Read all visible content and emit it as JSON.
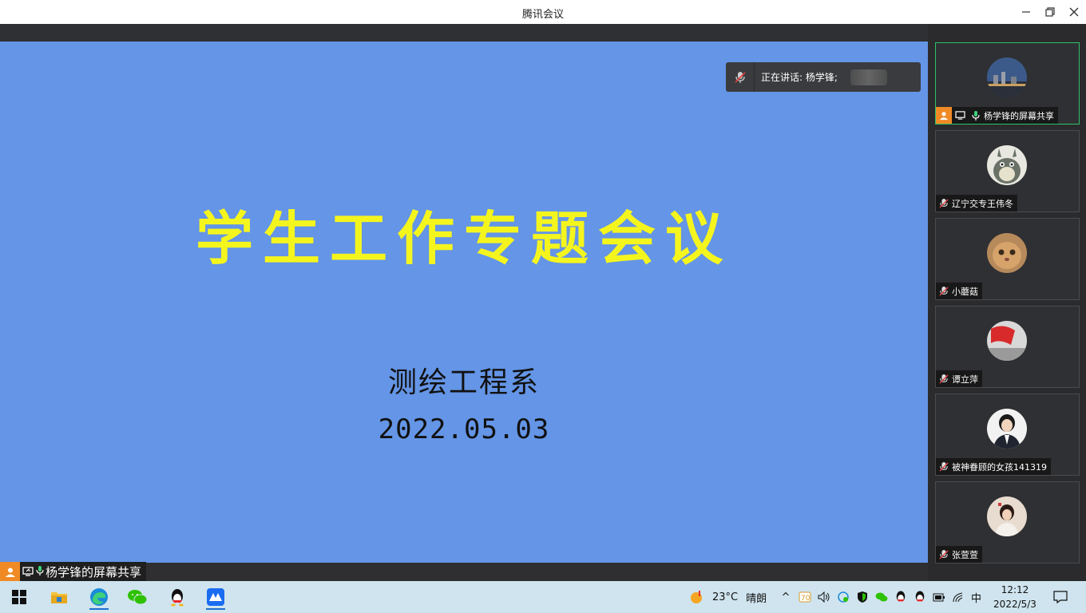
{
  "window": {
    "title": "腾讯会议"
  },
  "speaking": {
    "text": "正在讲话: 杨学锋;"
  },
  "slide": {
    "title": "学生工作专题会议",
    "subtitle": "测绘工程系",
    "date": "2022.05.03"
  },
  "share_label": "杨学锋的屏幕共享",
  "participants": [
    {
      "name": "杨学锋的屏幕共享",
      "active": true
    },
    {
      "name": "辽宁交专王伟冬"
    },
    {
      "name": "小蘑菇"
    },
    {
      "name": "谭立萍"
    },
    {
      "name": "被神眷顾的女孩141319"
    },
    {
      "name": "张萱萱"
    }
  ],
  "taskbar": {
    "weather_temp": "23°C",
    "weather_text": "晴朗",
    "ime": "中",
    "time": "12:12",
    "date": "2022/5/3"
  },
  "colors": {
    "slide_bg": "#6495e6",
    "title_yellow": "#f5f51e",
    "active_border": "#2ec26a",
    "share_orange": "#f08a25"
  }
}
